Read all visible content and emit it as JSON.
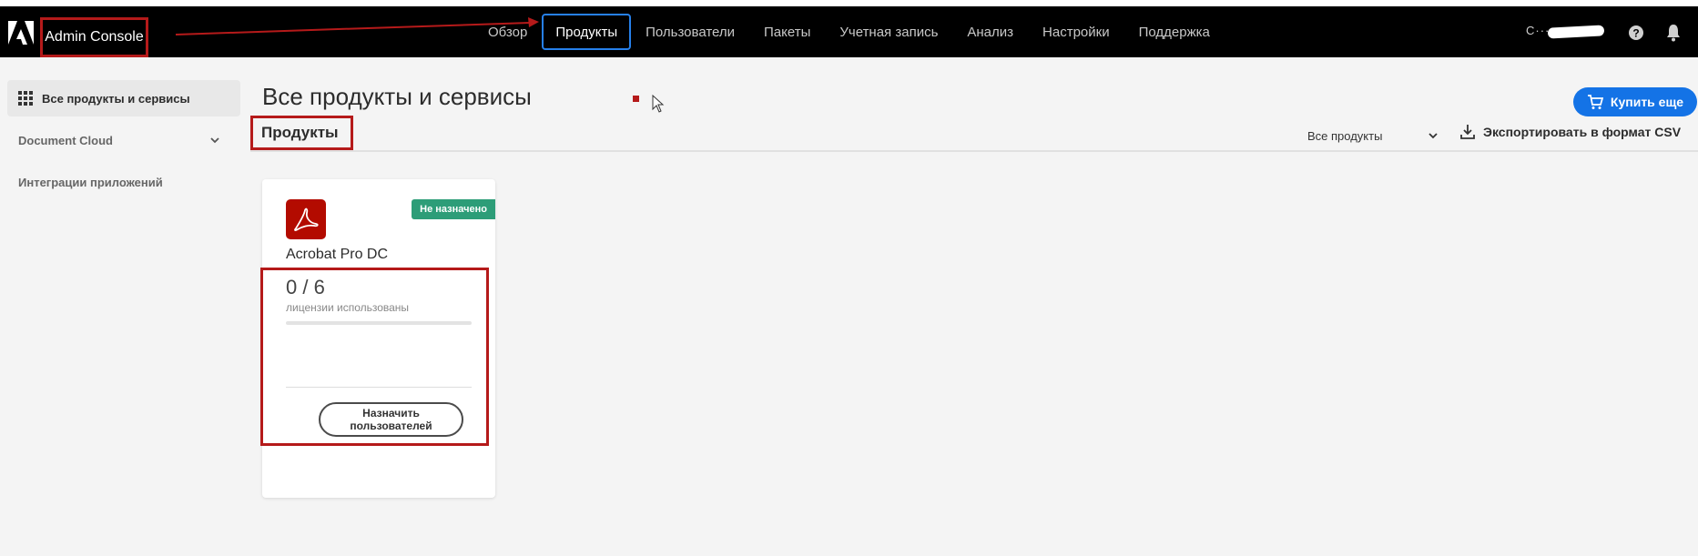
{
  "header": {
    "app_title": "Admin Console",
    "nav": [
      {
        "label": "Обзор",
        "active": false
      },
      {
        "label": "Продукты",
        "active": true
      },
      {
        "label": "Пользователи",
        "active": false
      },
      {
        "label": "Пакеты",
        "active": false
      },
      {
        "label": "Учетная запись",
        "active": false
      },
      {
        "label": "Анализ",
        "active": false
      },
      {
        "label": "Настройки",
        "active": false
      },
      {
        "label": "Поддержка",
        "active": false
      }
    ],
    "user_name": "C···········Z",
    "icons": [
      "adobe-logo-icon",
      "help-icon",
      "bell-icon"
    ]
  },
  "sidebar": {
    "items": [
      {
        "label": "Все продукты и сервисы",
        "active": true
      },
      {
        "label": "Document Cloud",
        "expandable": true
      },
      {
        "label": "Интеграции приложений"
      }
    ]
  },
  "main": {
    "title": "Все продукты и сервисы",
    "buy_button": "Купить еще",
    "section_tab": "Продукты",
    "filter_value": "Все продукты",
    "export_label": "Экспортировать в формат CSV",
    "card": {
      "product_name": "Acrobat Pro DC",
      "status": "Не назначено",
      "license_count": "0 / 6",
      "license_label": "лицензии использованы",
      "license_used_fraction": 0,
      "assign_button_line1": "Назначить",
      "assign_button_line2": "пользователей"
    }
  },
  "colors": {
    "topbar": "#000000",
    "accent": "#1473e6",
    "status_badge": "#2d9d78",
    "acrobat_red": "#b30b00",
    "annotation_red": "#b51a1a"
  }
}
